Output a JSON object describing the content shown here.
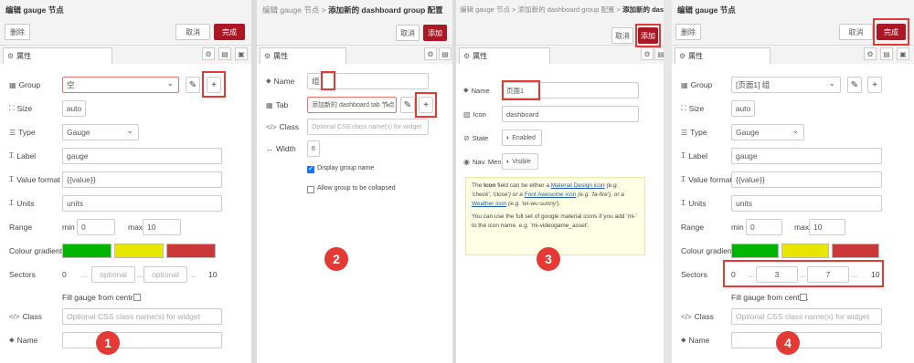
{
  "panel1": {
    "title": "编辑 gauge 节点",
    "delete_label": "删除",
    "cancel_label": "取消",
    "done_label": "完成",
    "tab_label": "属性",
    "group_label": "Group",
    "group_value": "空",
    "size_label": "Size",
    "size_value": "auto",
    "type_label": "Type",
    "type_value": "Gauge",
    "label_label": "Label",
    "label_value": "gauge",
    "format_label": "Value format",
    "format_value": "{{value}}",
    "units_label": "Units",
    "units_value": "units",
    "range_label": "Range",
    "min_label": "min",
    "min_value": "0",
    "max_label": "max",
    "max_value": "10",
    "colour_label": "Colour gradient",
    "colours": [
      "#00b500",
      "#e6e600",
      "#ca3838"
    ],
    "sectors_label": "Sectors",
    "sector_start": "0",
    "sector_ph1": "optional",
    "sector_ph2": "optional",
    "sector_end": "10",
    "fill_label": "Fill gauge from centre.",
    "class_label": "Class",
    "class_placeholder": "Optional CSS class name(s) for widget",
    "name_label": "Name",
    "badge": "1"
  },
  "panel2": {
    "crumb": "编辑 gauge 节点 >",
    "title": "添加新的 dashboard group 配置",
    "cancel_label": "取消",
    "add_label": "添加",
    "tab_label": "属性",
    "name_label": "Name",
    "name_value": "组",
    "tab_field_label": "Tab",
    "tab_value": "添加新的 dashboard tab 节点",
    "class_label": "Class",
    "class_placeholder": "Optional CSS class name(s) for widget",
    "width_label": "Width",
    "width_value": "6",
    "display_label": "Display group name",
    "collapse_label": "Allow group to be collapsed",
    "badge": "2"
  },
  "panel3": {
    "crumb": "编辑 gauge 节点 > 添加新的 dashboard group 配置 >",
    "title": "添加新的 dashboard tab 配置",
    "cancel_label": "取消",
    "add_label": "添加",
    "tab_label": "属性",
    "name_label": "Name",
    "name_value": "页面1",
    "icon_label": "Icon",
    "icon_value": "dashboard",
    "state_label": "State",
    "state_value": "Enabled",
    "nav_label": "Nav. Menu",
    "nav_value": "Visible",
    "info_p1_a": "The ",
    "info_p1_b": "Icon",
    "info_p1_c": " field can be either a ",
    "info_p1_d": "Material Design icon",
    "info_p1_e": " (e.g. 'check', 'close') or a ",
    "info_p1_f": "Font Awesome icon",
    "info_p1_g": " (e.g. 'fa-fire'), or a ",
    "info_p1_h": "Weather icon",
    "info_p1_i": " (e.g. 'wi-wu-sunny').",
    "info_p2": "You can use the full set of google material icons if you add 'mi-' to the icon name. e.g. 'mi-videogame_asset'.",
    "badge": "3"
  },
  "panel4": {
    "title": "编辑 gauge 节点",
    "delete_label": "删除",
    "cancel_label": "取消",
    "done_label": "完成",
    "tab_label": "属性",
    "group_label": "Group",
    "group_value": "[页面1] 组",
    "size_label": "Size",
    "size_value": "auto",
    "type_label": "Type",
    "type_value": "Gauge",
    "label_label": "Label",
    "label_value": "gauge",
    "format_label": "Value format",
    "format_value": "{{value}}",
    "units_label": "Units",
    "units_value": "units",
    "range_label": "Range",
    "min_label": "min",
    "min_value": "0",
    "max_label": "max",
    "max_value": "10",
    "colour_label": "Colour gradient",
    "colours": [
      "#00b500",
      "#e6e600",
      "#ca3838"
    ],
    "sectors_label": "Sectors",
    "sector_start": "0",
    "sector_v1": "3",
    "sector_v2": "7",
    "sector_end": "10",
    "fill_label": "Fill gauge from centre.",
    "class_label": "Class",
    "class_placeholder": "Optional CSS class name(s) for widget",
    "name_label": "Name",
    "badge": "4"
  }
}
